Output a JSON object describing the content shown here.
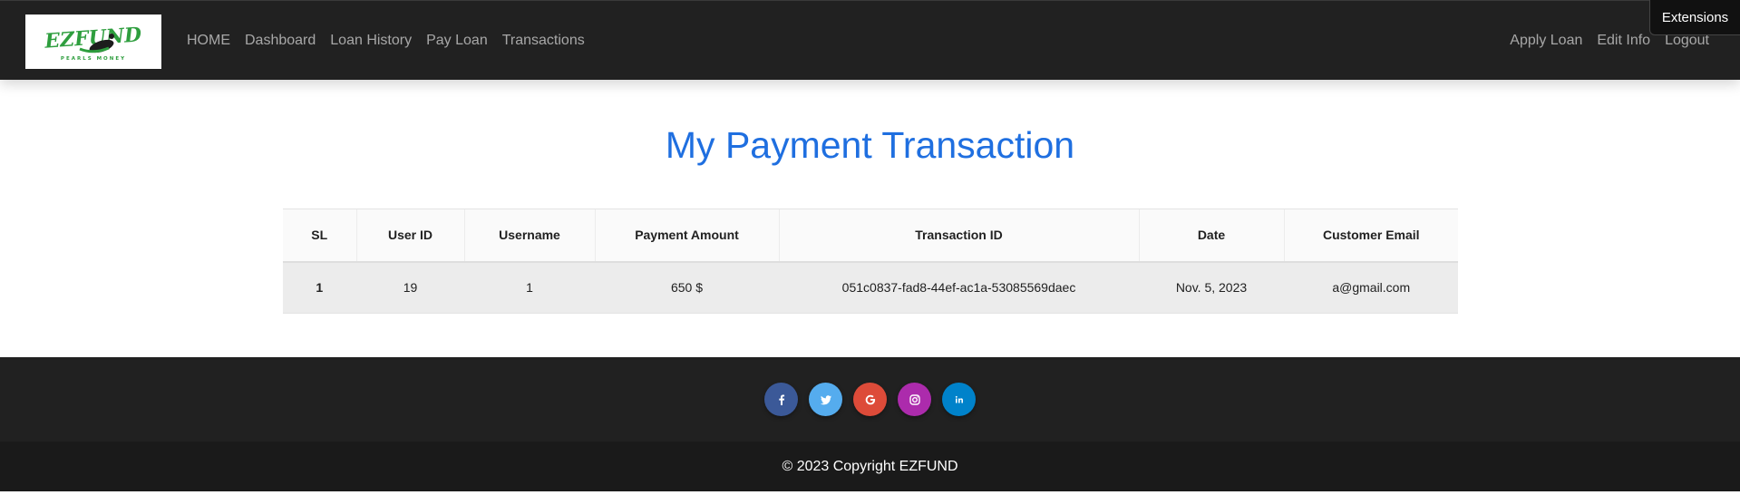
{
  "navbar": {
    "logo": {
      "brand_text": "EZFUND",
      "tagline": "PEARLS MONEY"
    },
    "left_links": [
      {
        "label": "HOME"
      },
      {
        "label": "Dashboard"
      },
      {
        "label": "Loan History"
      },
      {
        "label": "Pay Loan"
      },
      {
        "label": "Transactions"
      }
    ],
    "right_links": [
      {
        "label": "Apply Loan"
      },
      {
        "label": "Edit Info"
      },
      {
        "label": "Logout"
      }
    ]
  },
  "extensions_tooltip": "Extensions",
  "main": {
    "title": "My Payment Transaction",
    "table": {
      "headers": [
        "SL",
        "User ID",
        "Username",
        "Payment Amount",
        "Transaction ID",
        "Date",
        "Customer Email"
      ],
      "rows": [
        [
          "1",
          "19",
          "1",
          "650 $",
          "051c0837-fad8-44ef-ac1a-53085569daec",
          "Nov. 5, 2023",
          "a@gmail.com"
        ]
      ]
    }
  },
  "footer": {
    "social": [
      {
        "icon": "facebook-icon",
        "color": "#3b5998"
      },
      {
        "icon": "twitter-icon",
        "color": "#55acee"
      },
      {
        "icon": "google-icon",
        "color": "#dd4b39"
      },
      {
        "icon": "instagram-icon",
        "color": "#ac2bac"
      },
      {
        "icon": "linkedin-icon",
        "color": "#0082ca"
      }
    ],
    "copyright": "© 2023 Copyright EZFUND"
  },
  "colors": {
    "title_blue": "#1f6fe0",
    "navbar_bg": "#212121",
    "footer_copy_bg": "#1a1a1a",
    "logo_green": "#2e9e3e"
  }
}
